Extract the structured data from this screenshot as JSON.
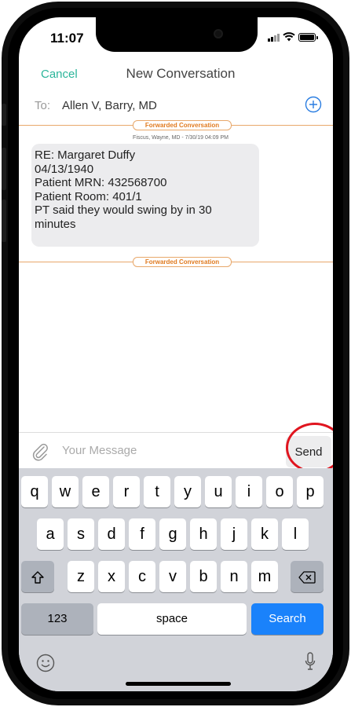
{
  "status_bar": {
    "time": "11:07"
  },
  "nav": {
    "cancel_label": "Cancel",
    "title": "New Conversation"
  },
  "recipient": {
    "prefix": "To:",
    "value": "Allen V, Barry, MD"
  },
  "forwarded": {
    "label": "Forwarded Conversation",
    "meta": "Fiscus, Wayne, MD - 7/30/19 04:09 PM",
    "message_lines": [
      "RE: Margaret Duffy",
      "04/13/1940",
      "Patient MRN: 432568700",
      "Patient Room: 401/1",
      "PT said they would swing by in 30",
      "minutes"
    ]
  },
  "composer": {
    "placeholder": "Your Message",
    "send_label": "Send"
  },
  "keyboard": {
    "row1": [
      "q",
      "w",
      "e",
      "r",
      "t",
      "y",
      "u",
      "i",
      "o",
      "p"
    ],
    "row2": [
      "a",
      "s",
      "d",
      "f",
      "g",
      "h",
      "j",
      "k",
      "l"
    ],
    "row3": [
      "z",
      "x",
      "c",
      "v",
      "b",
      "n",
      "m"
    ],
    "numbers_label": "123",
    "space_label": "space",
    "action_label": "Search"
  },
  "colors": {
    "accent": "#2bb59a",
    "forward": "#e07a1f",
    "highlight": "#e0151f",
    "action_key": "#1a82fb"
  }
}
